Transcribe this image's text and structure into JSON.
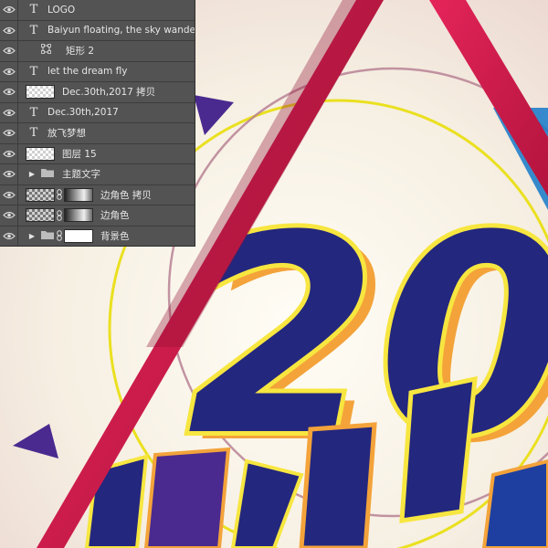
{
  "layers": [
    {
      "kind": "text",
      "name": "LOGO",
      "visible": true,
      "thumb_icon": "text-layer-icon"
    },
    {
      "kind": "text",
      "name": "Baiyun floating, the sky wander",
      "visible": true,
      "thumb_icon": "text-layer-icon"
    },
    {
      "kind": "shape",
      "name": "矩形 2",
      "visible": true,
      "thumb_icon": "shape-layer-icon"
    },
    {
      "kind": "text",
      "name": "let the dream fly",
      "visible": true,
      "thumb_icon": "text-layer-icon"
    },
    {
      "kind": "pixel",
      "name": "Dec.30th,2017 拷贝",
      "visible": true,
      "thumb_icon": "transparent-thumbnail"
    },
    {
      "kind": "text",
      "name": "Dec.30th,2017",
      "visible": true,
      "thumb_icon": "text-layer-icon"
    },
    {
      "kind": "text",
      "name": "放飞梦想",
      "visible": true,
      "thumb_icon": "text-layer-icon"
    },
    {
      "kind": "pixel",
      "name": "图层 15",
      "visible": true,
      "thumb_icon": "transparent-thumbnail"
    },
    {
      "kind": "group",
      "name": "主题文字",
      "visible": true,
      "thumb_icon": "folder-icon"
    },
    {
      "kind": "masked",
      "name": "边角色 拷贝",
      "visible": true,
      "thumb_icon": "layer-mask-thumbnail"
    },
    {
      "kind": "masked",
      "name": "边角色",
      "visible": true,
      "thumb_icon": "layer-mask-thumbnail"
    },
    {
      "kind": "group-masked",
      "name": "背景色",
      "visible": true,
      "thumb_icon": "folder-icon"
    }
  ],
  "canvas": {
    "headline_text": "20",
    "colors": {
      "background": "#f3ece0",
      "digit_fill": "#23277e",
      "digit_outline": "#f7e640",
      "digit_shadow": "#f3a33a",
      "triangle_stroke": "#d8204e",
      "accent_purple": "#4a2a8f",
      "accent_blue": "#1479c9",
      "circle_stroke": "#eae020"
    }
  }
}
